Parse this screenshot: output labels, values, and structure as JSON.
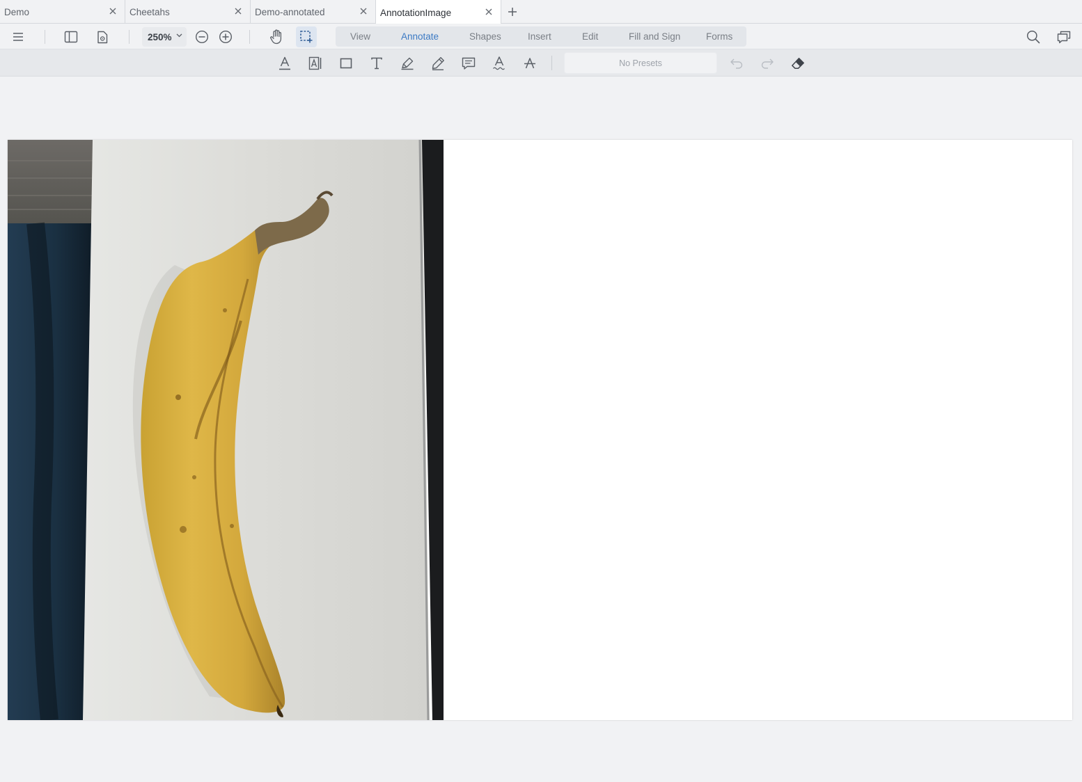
{
  "tabs": [
    {
      "label": "Demo",
      "active": false
    },
    {
      "label": "Cheetahs",
      "active": false
    },
    {
      "label": "Demo-annotated",
      "active": false
    },
    {
      "label": "AnnotationImage",
      "active": true
    }
  ],
  "new_tab_icon": "plus-icon",
  "toolbar": {
    "zoom_level": "250%",
    "ribbon_tabs": [
      "View",
      "Annotate",
      "Shapes",
      "Insert",
      "Edit",
      "Fill and Sign",
      "Forms"
    ],
    "active_ribbon_tab": "Annotate",
    "icons": [
      "menu-icon",
      "sidebar-panel-icon",
      "page-settings-icon",
      "zoom-out-icon",
      "zoom-in-icon",
      "pan-hand-icon",
      "region-select-icon",
      "search-icon",
      "comments-panel-icon"
    ]
  },
  "annotate_bar": {
    "tools": [
      "underline-text-icon",
      "text-area-icon",
      "rectangle-shape-icon",
      "free-text-icon",
      "highlight-pen-icon",
      "freehand-pen-icon",
      "comment-note-icon",
      "squiggly-text-icon",
      "strikeout-text-icon"
    ],
    "presets_label": "No Presets",
    "actions": [
      "undo-icon",
      "redo-icon",
      "eraser-icon"
    ]
  },
  "colors": {
    "accent": "#3c7ac4",
    "background": "#f1f2f4",
    "page": "#ffffff"
  }
}
